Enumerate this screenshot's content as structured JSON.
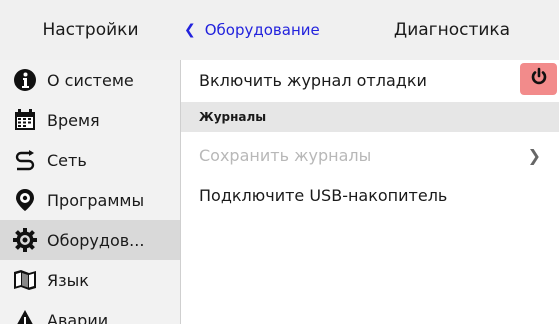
{
  "header": {
    "app_title": "Настройки",
    "back_label": "Оборудование",
    "page_title": "Диагностика"
  },
  "sidebar": {
    "items": [
      {
        "label": "О системе",
        "icon": "info-icon"
      },
      {
        "label": "Время",
        "icon": "calendar-icon"
      },
      {
        "label": "Сеть",
        "icon": "network-icon"
      },
      {
        "label": "Программы",
        "icon": "apps-icon"
      },
      {
        "label": "Оборудов...",
        "icon": "gear-icon",
        "active": true
      },
      {
        "label": "Язык",
        "icon": "map-icon"
      },
      {
        "label": "Аварии",
        "icon": "warning-icon"
      }
    ]
  },
  "content": {
    "debug_log_label": "Включить  журнал отладки",
    "logs_section": "Журналы",
    "save_logs_label": "Сохранить журналы",
    "usb_hint": "Подключите USB-накопитель"
  },
  "colors": {
    "accent": "#2222dd",
    "power_button": "#f28b8b",
    "active_item": "#d9d9d9"
  }
}
